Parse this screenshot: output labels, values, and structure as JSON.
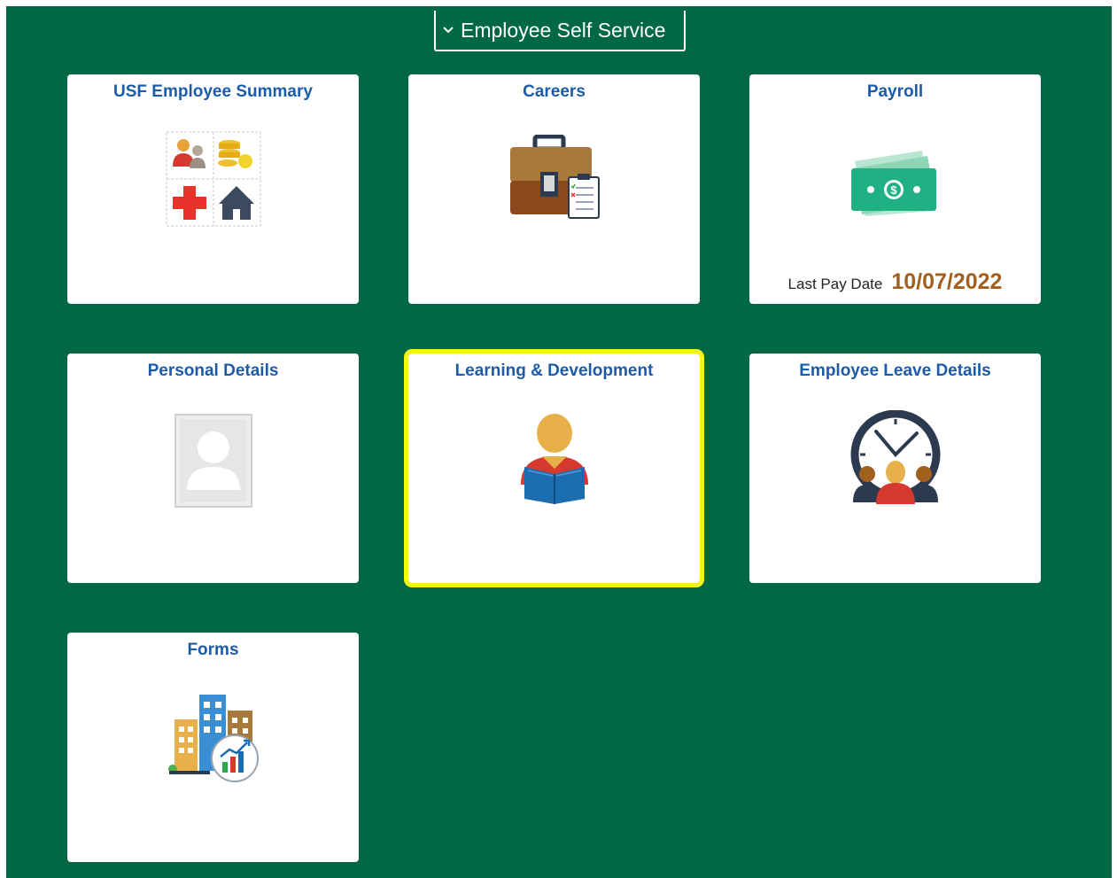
{
  "header": {
    "homepage_label": "Employee Self Service"
  },
  "tiles": [
    {
      "title": "USF Employee Summary"
    },
    {
      "title": "Careers"
    },
    {
      "title": "Payroll",
      "detail_label": "Last Pay Date",
      "detail_value": "10/07/2022"
    },
    {
      "title": "Personal Details"
    },
    {
      "title": "Learning & Development"
    },
    {
      "title": "Employee Leave Details"
    },
    {
      "title": "Forms"
    }
  ],
  "colors": {
    "background": "#006747",
    "tile_title": "#1c5ba8",
    "focus_outline": "#f5f51a",
    "pay_date": "#a2601f"
  },
  "focused_tile": "Learning & Development"
}
